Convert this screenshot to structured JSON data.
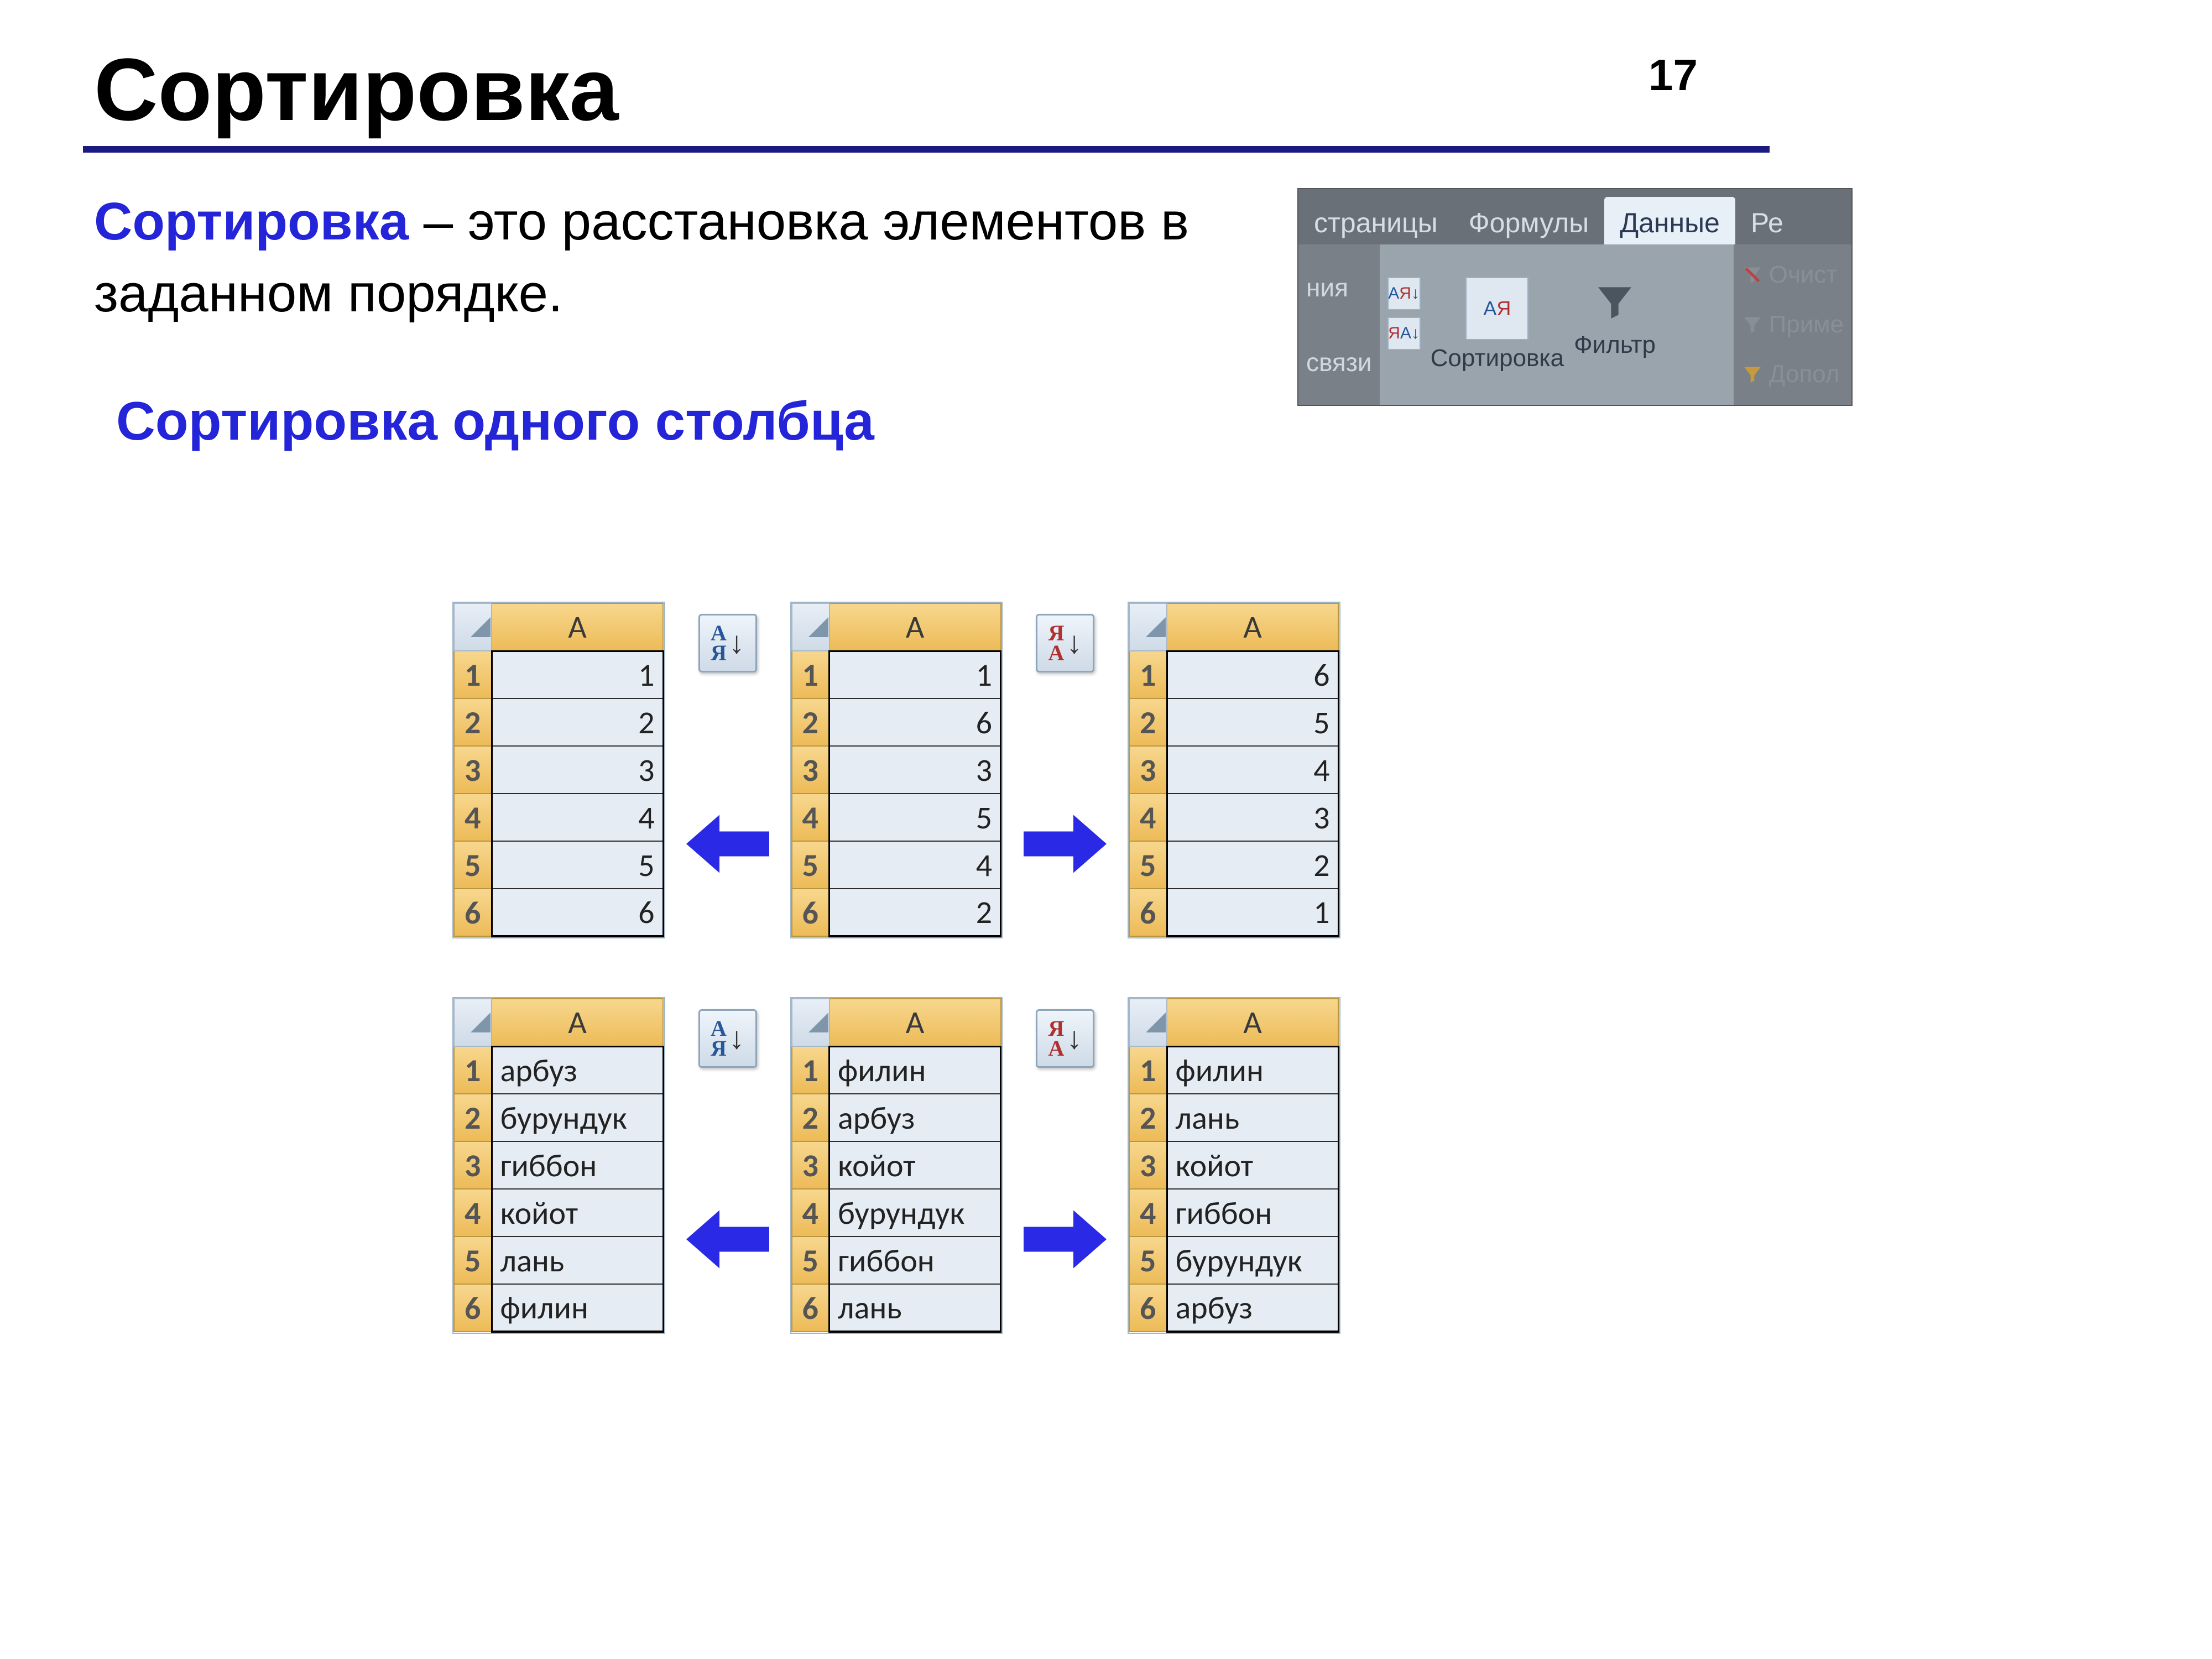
{
  "page_number": "17",
  "title": "Сортировка",
  "definition_term": "Сортировка",
  "definition_tail": " – это расстановка элементов в заданном порядке.",
  "subheading": "Сортировка одного столбца",
  "ribbon": {
    "tab_left": "страницы",
    "tab_formulas": "Формулы",
    "tab_data": "Данные",
    "tab_right": "Ре",
    "left_item_top": "ния",
    "left_item_bottom": "связи",
    "sort_label": "Сортировка",
    "filter_label": "Фильтр",
    "side1": "Очист",
    "side2": "Приме",
    "side3": "Допол"
  },
  "col_label": "A",
  "rows": [
    "1",
    "2",
    "3",
    "4",
    "5",
    "6"
  ],
  "numbers_asc": [
    "1",
    "2",
    "3",
    "4",
    "5",
    "6"
  ],
  "numbers_src": [
    "1",
    "6",
    "3",
    "5",
    "4",
    "2"
  ],
  "numbers_desc": [
    "6",
    "5",
    "4",
    "3",
    "2",
    "1"
  ],
  "words_asc": [
    "арбуз",
    "бурундук",
    "гиббон",
    "койот",
    "лань",
    "филин"
  ],
  "words_src": [
    "филин",
    "арбуз",
    "койот",
    "бурундук",
    "гиббон",
    "лань"
  ],
  "words_desc": [
    "филин",
    "лань",
    "койот",
    "гиббон",
    "бурундук",
    "арбуз"
  ]
}
